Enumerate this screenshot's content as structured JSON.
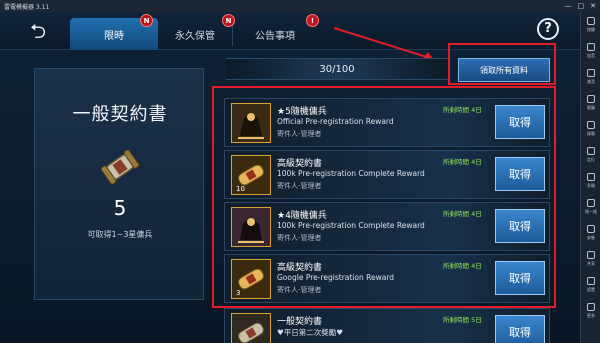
{
  "emulator": {
    "title": "雷電模擬器 3.11",
    "window_buttons": [
      "—",
      "□",
      "✕"
    ],
    "tools": [
      {
        "label": "按鍵",
        "icon": "keyboard-icon"
      },
      {
        "label": "加音",
        "icon": "volume-up-icon"
      },
      {
        "label": "減音",
        "icon": "volume-down-icon"
      },
      {
        "label": "截圖",
        "icon": "screenshot-icon"
      },
      {
        "label": "錄製",
        "icon": "record-icon"
      },
      {
        "label": "定位",
        "icon": "location-icon"
      },
      {
        "label": "多開",
        "icon": "multi-instance-icon"
      },
      {
        "label": "搖一搖",
        "icon": "shake-icon"
      },
      {
        "label": "安裝",
        "icon": "apk-install-icon"
      },
      {
        "label": "共享",
        "icon": "share-icon"
      },
      {
        "label": "設置",
        "icon": "settings-icon"
      },
      {
        "label": "更多",
        "icon": "more-icon"
      }
    ]
  },
  "header": {
    "back_label": "⮌",
    "tabs": [
      {
        "label": "限時",
        "active": true,
        "badge": ""
      },
      {
        "label": "永久保管",
        "active": false,
        "badge": "N"
      },
      {
        "label": "公告事項",
        "active": false,
        "badge": "N"
      }
    ],
    "extra_badge": "!",
    "help_label": "?"
  },
  "left_panel": {
    "title": "一般契約書",
    "count": "5",
    "description": "可取得1~3星傭兵"
  },
  "counter": {
    "text": "30/100"
  },
  "claim_all": {
    "label": "領取所有資料"
  },
  "mail_rows": [
    {
      "title": "★5隨機傭兵",
      "subtitle": "Official Pre-registration Reward",
      "sender": "寄件人-管理者",
      "time": "所剩時間 4日",
      "button": "取得",
      "icon_number": "",
      "icon": "mercenary-icon"
    },
    {
      "title": "高級契約書",
      "subtitle": "100k Pre-registration Complete Reward",
      "sender": "寄件人-管理者",
      "time": "所剩時間 4日",
      "button": "取得",
      "icon_number": "10",
      "icon": "contract-scroll-icon"
    },
    {
      "title": "★4隨機傭兵",
      "subtitle": "100k Pre-registration Complete Reward",
      "sender": "寄件人-管理者",
      "time": "所剩時間 4日",
      "button": "取得",
      "icon_number": "",
      "icon": "mercenary-icon"
    },
    {
      "title": "高級契約書",
      "subtitle": "Google Pre-registration Reward",
      "sender": "寄件人-管理者",
      "time": "所剩時間 4日",
      "button": "取得",
      "icon_number": "3",
      "icon": "contract-scroll-icon"
    },
    {
      "title": "一般契約書",
      "subtitle": "♥平日第二次獎勵♥",
      "sender": "",
      "time": "所剩時間 5日",
      "button": "取得",
      "icon_number": "",
      "icon": "contract-scroll-icon"
    }
  ],
  "colors": {
    "accent_blue": "#1f6fb0",
    "highlight_red": "#e11d2a",
    "time_green": "#8fe25a",
    "badge_red": "#b9131a"
  }
}
